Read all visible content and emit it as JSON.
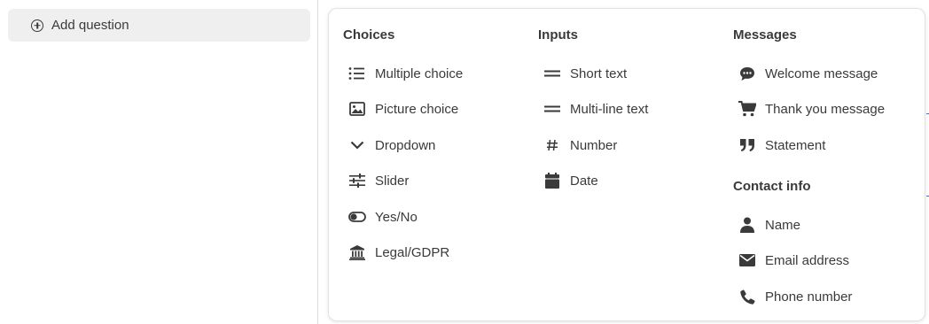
{
  "add_question": {
    "label": "Add question"
  },
  "menu": {
    "choices": {
      "title": "Choices",
      "items": [
        {
          "label": "Multiple choice",
          "icon": "list-icon"
        },
        {
          "label": "Picture choice",
          "icon": "image-icon"
        },
        {
          "label": "Dropdown",
          "icon": "chevron-down-icon"
        },
        {
          "label": "Slider",
          "icon": "slider-icon"
        },
        {
          "label": "Yes/No",
          "icon": "toggle-icon"
        },
        {
          "label": "Legal/GDPR",
          "icon": "bank-icon"
        }
      ]
    },
    "inputs": {
      "title": "Inputs",
      "items": [
        {
          "label": "Short text",
          "icon": "short-text-icon"
        },
        {
          "label": "Multi-line text",
          "icon": "multiline-text-icon"
        },
        {
          "label": "Number",
          "icon": "hash-icon"
        },
        {
          "label": "Date",
          "icon": "calendar-icon"
        }
      ]
    },
    "messages": {
      "title": "Messages",
      "items": [
        {
          "label": "Welcome message",
          "icon": "chat-bubble-icon"
        },
        {
          "label": "Thank you message",
          "icon": "cart-icon"
        },
        {
          "label": "Statement",
          "icon": "quote-icon"
        }
      ]
    },
    "contact": {
      "title": "Contact info",
      "items": [
        {
          "label": "Name",
          "icon": "person-icon"
        },
        {
          "label": "Email address",
          "icon": "envelope-icon"
        },
        {
          "label": "Phone number",
          "icon": "phone-icon"
        }
      ]
    }
  },
  "colors": {
    "text": "#3a3a3a",
    "button_bg": "#efefef",
    "accent": "#3b6fd4"
  }
}
